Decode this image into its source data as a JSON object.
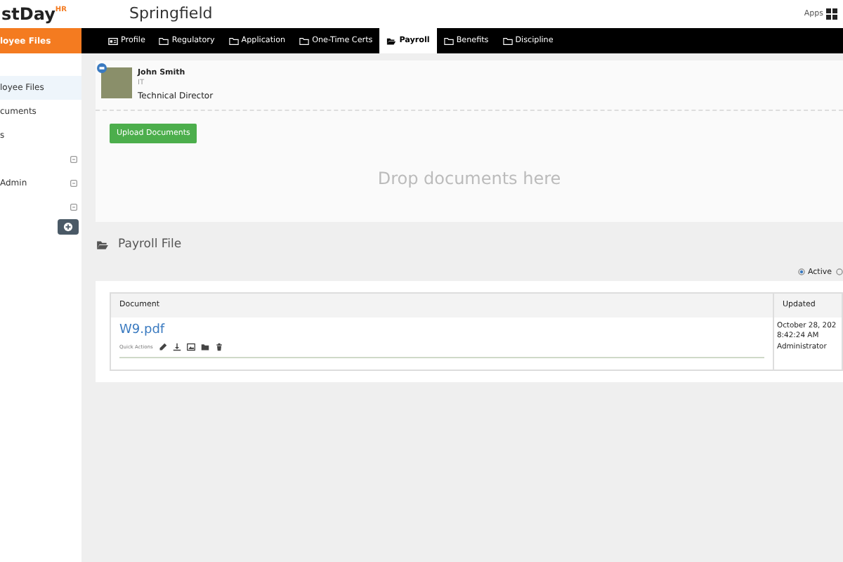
{
  "brand": {
    "name": "stDay",
    "sup": "HR"
  },
  "company": "Springfield",
  "apps_label": "Apps",
  "section_label": "loyee Files",
  "tabs": [
    {
      "label": "Profile",
      "kind": "card",
      "selected": false
    },
    {
      "label": "Regulatory",
      "kind": "folder",
      "selected": false
    },
    {
      "label": "Application",
      "kind": "folder",
      "selected": false
    },
    {
      "label": "One-Time Certs",
      "kind": "folder",
      "selected": false
    },
    {
      "label": "Payroll",
      "kind": "open-folder",
      "selected": true
    },
    {
      "label": "Benefits",
      "kind": "folder",
      "selected": false
    },
    {
      "label": "Discipline",
      "kind": "folder",
      "selected": false
    }
  ],
  "sidebar": {
    "items": [
      {
        "label": "loyee Files",
        "expandable": false,
        "selected": true
      },
      {
        "label": "cuments",
        "expandable": false,
        "selected": false
      },
      {
        "label": "s",
        "expandable": false,
        "selected": false
      },
      {
        "expandable": true,
        "selected": false
      },
      {
        "label": "Admin",
        "expandable": true,
        "selected": false
      },
      {
        "expandable": true,
        "selected": false
      }
    ]
  },
  "employee": {
    "name": "John Smith",
    "department": "IT",
    "title": "Technical Director"
  },
  "upload_button": "Upload Documents",
  "dropzone_text": "Drop documents here",
  "payroll": {
    "title": "Payroll File",
    "filters": [
      {
        "label": "Active",
        "selected": true
      },
      {
        "selected": false
      }
    ],
    "table": {
      "columns": [
        "Document",
        "Updated"
      ],
      "rows": [
        {
          "document": "W9.pdf",
          "quick_actions_label": "Quick Actions",
          "updated": [
            "October 28, 202",
            "8:42:24 AM",
            "Administrator"
          ]
        }
      ]
    }
  }
}
